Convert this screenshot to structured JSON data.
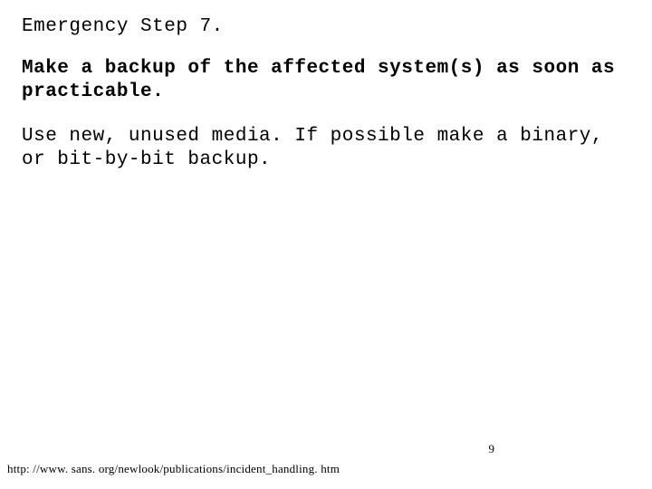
{
  "slide": {
    "title": "Emergency Step 7.",
    "main_text": "Make a backup of the affected system(s) as soon as practicable.",
    "body_text": "Use new, unused media. If possible make a binary, or bit-by-bit backup.",
    "page_number": "9",
    "footer_url": "http: //www. sans. org/newlook/publications/incident_handling. htm"
  }
}
